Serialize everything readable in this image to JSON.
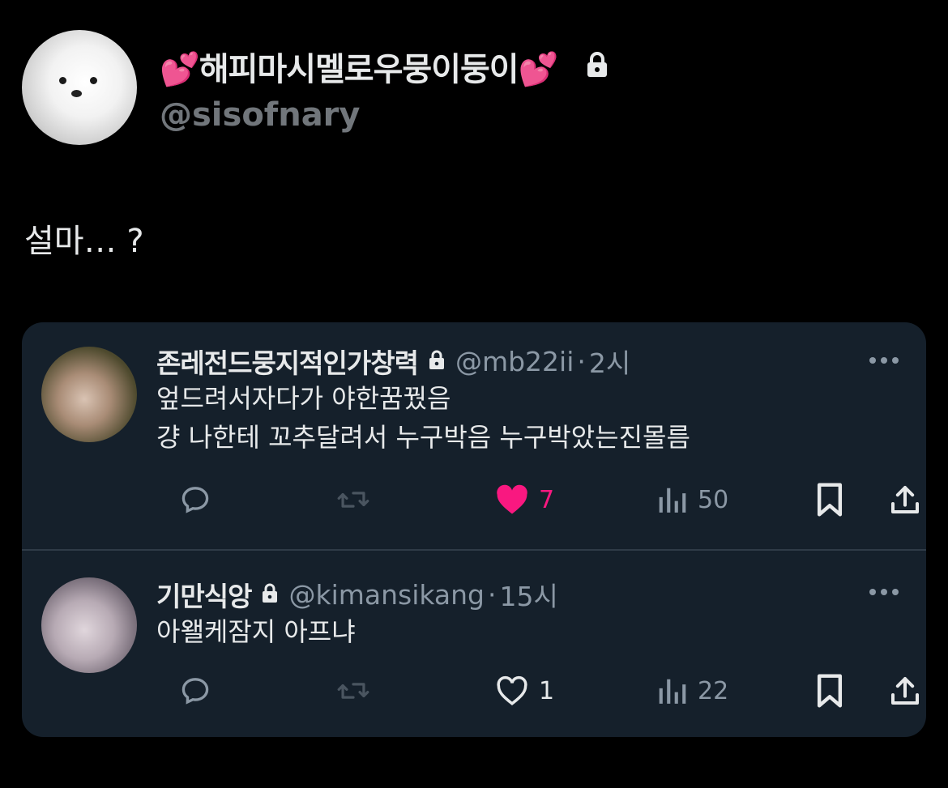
{
  "author": {
    "display_name": "해피마시멜로우뭉이둥이",
    "name_emoji": "💕",
    "handle": "@sisofnary",
    "protected": true
  },
  "tweet": {
    "text": "설마… ?"
  },
  "replies": [
    {
      "name": "존레전드뭉지적인가창력",
      "protected": true,
      "handle": "@mb22ii",
      "separator": "·",
      "time": "2시",
      "lines": [
        "엎드려서자다가 야한꿈꿨음",
        "걍 나한테 꼬추달려서 누구박음 누구박았는진몰름"
      ],
      "likes": "7",
      "liked": true,
      "views": "50"
    },
    {
      "name": "기만식앙",
      "protected": true,
      "handle": "@kimansikang",
      "separator": "·",
      "time": "15시",
      "lines": [
        "아왤케잠지 아프냐"
      ],
      "likes": "1",
      "liked": false,
      "views": "22"
    }
  ],
  "colors": {
    "background": "#000000",
    "card": "#15202b",
    "muted": "#8b98a5",
    "like": "#f91880"
  }
}
